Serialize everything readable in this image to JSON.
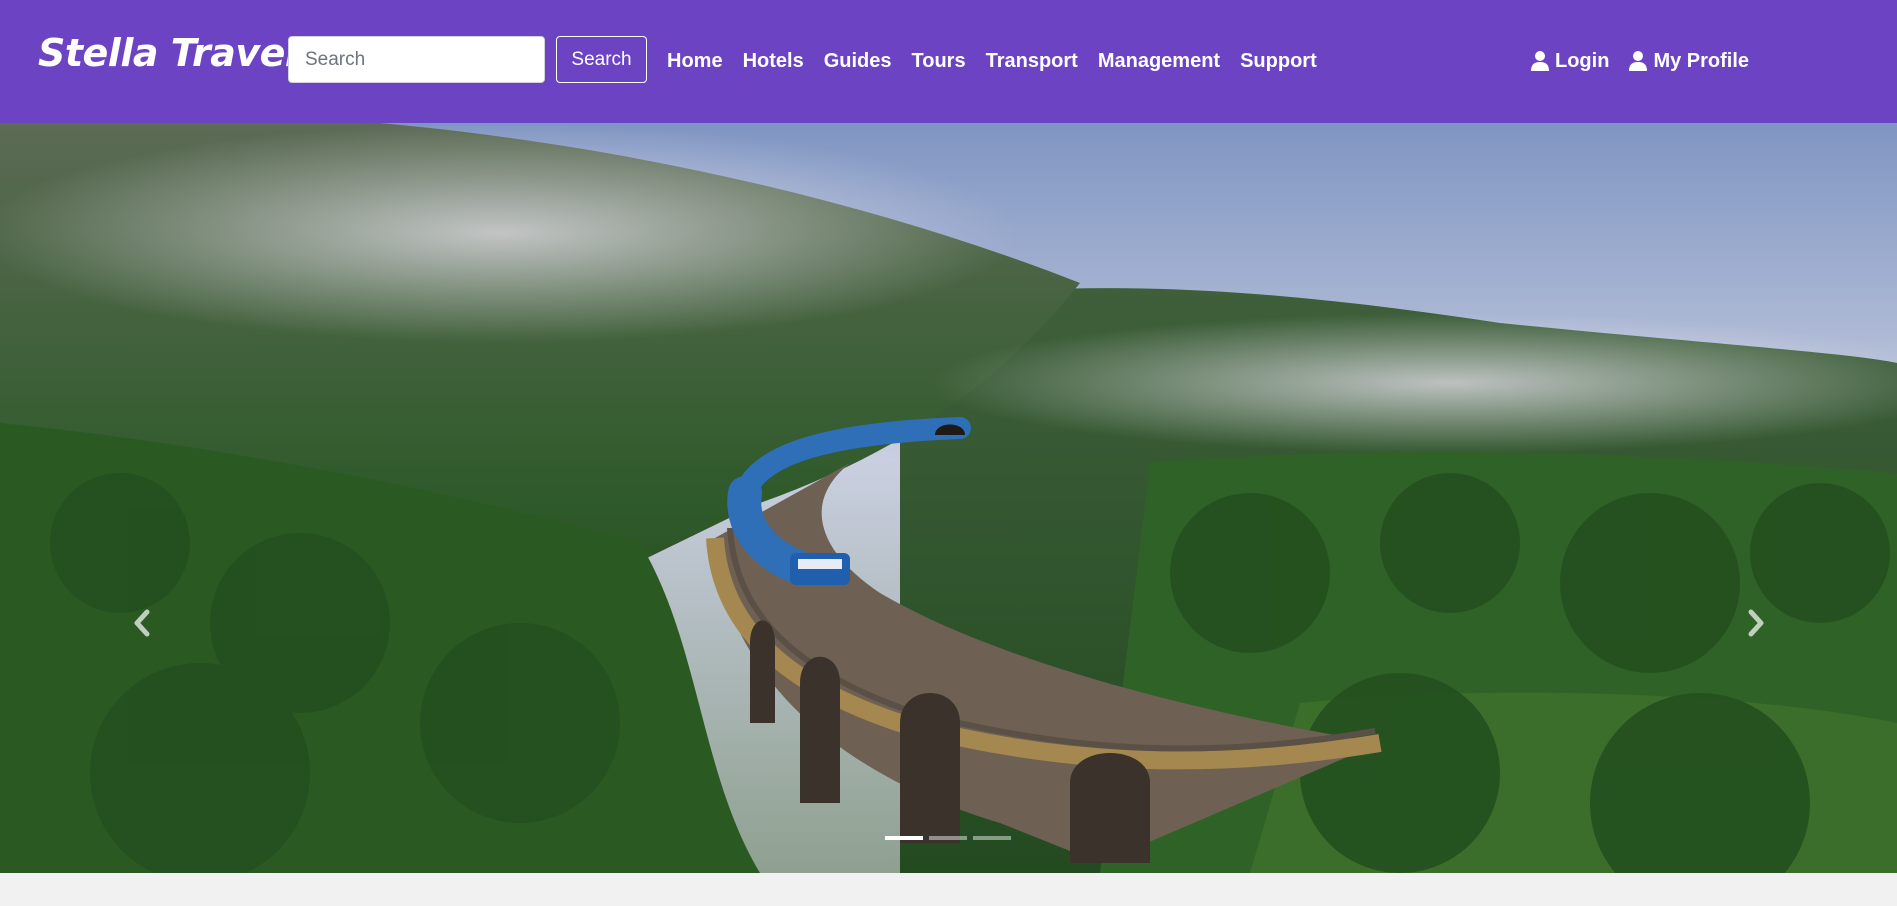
{
  "brand": {
    "name": "Stella Travel"
  },
  "search": {
    "placeholder": "Search",
    "value": "",
    "button_label": "Search"
  },
  "nav": {
    "items": [
      {
        "label": "Home"
      },
      {
        "label": "Hotels"
      },
      {
        "label": "Guides"
      },
      {
        "label": "Tours"
      },
      {
        "label": "Transport"
      },
      {
        "label": "Management"
      },
      {
        "label": "Support"
      }
    ],
    "right": [
      {
        "label": "Login",
        "icon": "user-icon"
      },
      {
        "label": "My Profile",
        "icon": "user-icon"
      }
    ]
  },
  "carousel": {
    "slide_description_icon": "train-on-arched-bridge-photo",
    "prev_icon": "chevron-left-icon",
    "next_icon": "chevron-right-icon",
    "slide_count": 3,
    "active_slide": 1
  },
  "colors": {
    "navbar": "#6c44c3",
    "page_background": "#f1f1f1",
    "nav_text": "#ffffff"
  }
}
